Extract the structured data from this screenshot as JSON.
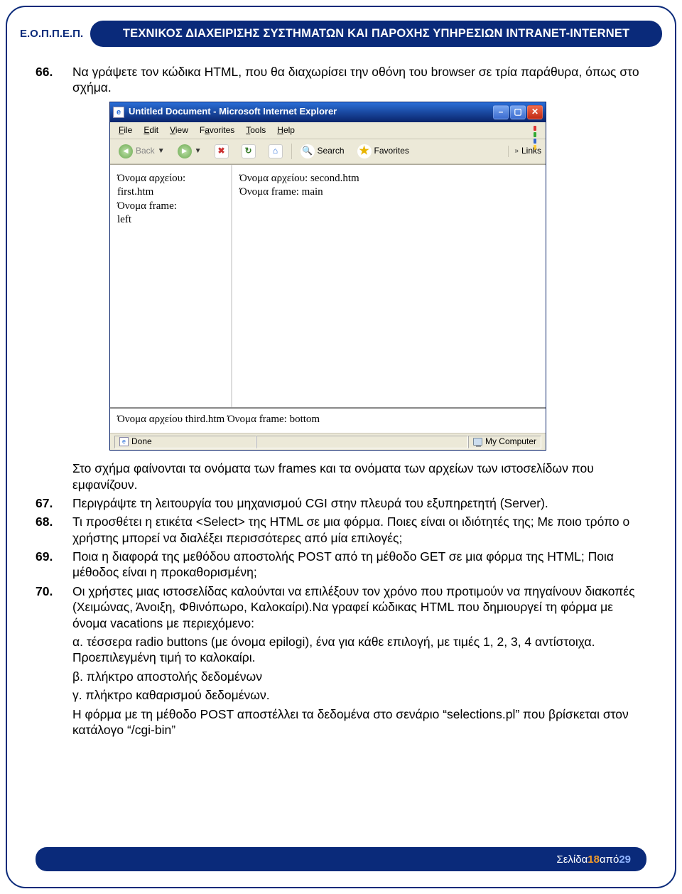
{
  "header": {
    "org": "Ε.Ο.Π.Π.Ε.Π.",
    "title": "ΤΕΧΝΙΚΟΣ ΔΙΑΧΕΙΡΙΣΗΣ ΣΥΣΤΗΜΑΤΩΝ ΚΑΙ ΠΑΡΟΧΗΣ ΥΠΗΡΕΣΙΩΝ INTRANET-INTERNET"
  },
  "questions": {
    "q66": "Να γράψετε τον κώδικα HTML, που θα διαχωρίσει την οθόνη του browser  σε τρία παράθυρα, όπως στο σχήμα.",
    "q66_after": "Στο σχήμα φαίνονται τα ονόματα των frames και τα ονόματα των αρχείων των ιστοσελίδων που εμφανίζουν.",
    "q67": "Περιγράψτε τη λειτουργία του μηχανισμού CGI στην πλευρά του εξυπηρετητή (Server).",
    "q68": "Τι προσθέτει η ετικέτα <Select> της HTML σε μια φόρμα. Ποιες είναι οι ιδιότητές της; Με ποιο τρόπο ο χρήστης μπορεί να διαλέξει περισσότερες από μία επιλογές;",
    "q69": "Ποια η διαφορά της μεθόδου αποστολής POST από τη μέθοδο GET σε μια φόρμα της HTML; Ποια μέθοδος είναι η προκαθορισμένη;",
    "q70_intro": "Οι χρήστες μιας ιστοσελίδας καλούνται να επιλέξουν τον χρόνο που προτιμούν να πηγαίνουν διακοπές (Χειμώνας, Άνοιξη, Φθινόπωρο, Καλοκαίρι).Να γραφεί κώδικας HTML που δημιουργεί τη φόρμα με όνομα vacations με περιεχόμενο:",
    "q70_a": "α. τέσσερα radio buttons (με όνομα epilogi), ένα για κάθε επιλογή, με τιμές 1, 2, 3, 4 αντίστοιχα. Προεπιλεγμένη τιμή το καλοκαίρι.",
    "q70_b": "β. πλήκτρο αποστολής δεδομένων",
    "q70_c": "γ. πλήκτρο καθαρισμού δεδομένων.",
    "q70_end": "Η φόρμα με τη μέθοδο POST  αποστέλλει τα δεδομένα στο σενάριο “selections.pl” που βρίσκεται στον κατάλογο “/cgi-bin”"
  },
  "ie": {
    "title": "Untitled Document - Microsoft Internet Explorer",
    "menus": {
      "file": "File",
      "edit": "Edit",
      "view": "View",
      "favorites": "Favorites",
      "tools": "Tools",
      "help": "Help"
    },
    "toolbar": {
      "back": "Back",
      "search": "Search",
      "favorites": "Favorites",
      "links": "Links"
    },
    "frames": {
      "left_l1": "Όνομα αρχείου:",
      "left_l2": "first.htm",
      "left_l3": "Όνομα frame:",
      "left_l4": "left",
      "main_l1": "Όνομα αρχείου: second.htm",
      "main_l2": "Όνομα frame: main",
      "bottom": "Όνομα αρχείου third.htm Όνομα frame: bottom"
    },
    "status": {
      "done": "Done",
      "zone": "My Computer"
    }
  },
  "footer": {
    "label": "Σελίδα ",
    "current": "18",
    "mid": " από ",
    "total": "29"
  }
}
